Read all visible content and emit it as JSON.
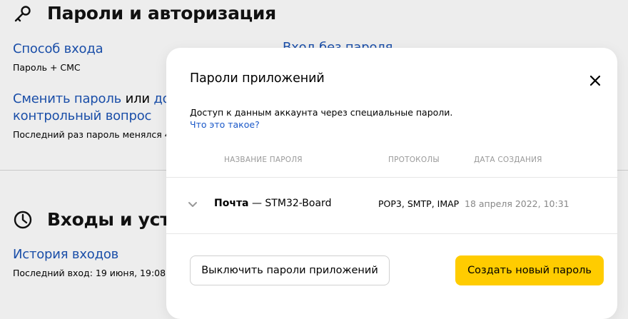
{
  "background": {
    "passwords_section": {
      "title": "Пароли и авторизация",
      "login_method": {
        "label": "Способ входа",
        "value": "Пароль + СМС"
      },
      "passwordless_link": "Вход без пароля",
      "change_password": {
        "link": "Сменить пароль",
        "conjunction": " или ",
        "link_cont": "до",
        "line2": "контрольный вопрос",
        "note": "Последний раз пароль менялся 4"
      }
    },
    "logins_section": {
      "title": "Входы и устр",
      "history_link": "История входов",
      "last_login": "Последний вход: 19 июня, 19:08,"
    }
  },
  "modal": {
    "title": "Пароли приложений",
    "description": "Доступ к данным аккаунта через специальные пароли.",
    "help_link": "Что это такое?",
    "columns": {
      "name": "НАЗВАНИЕ ПАРОЛЯ",
      "protocols": "ПРОТОКОЛЫ",
      "created": "ДАТА СОЗДАНИЯ"
    },
    "passwords": [
      {
        "service": "Почта",
        "separator": " — ",
        "name": "STM32-Board",
        "protocols": "POP3, SMTP, IMAP",
        "created": "18 апреля 2022, 10:31"
      }
    ],
    "buttons": {
      "disable": "Выключить пароли приложений",
      "create": "Создать новый пароль"
    }
  },
  "colors": {
    "link": "#1a4ea8",
    "primary_button": "#ffcc00",
    "page_background": "#ededed"
  }
}
